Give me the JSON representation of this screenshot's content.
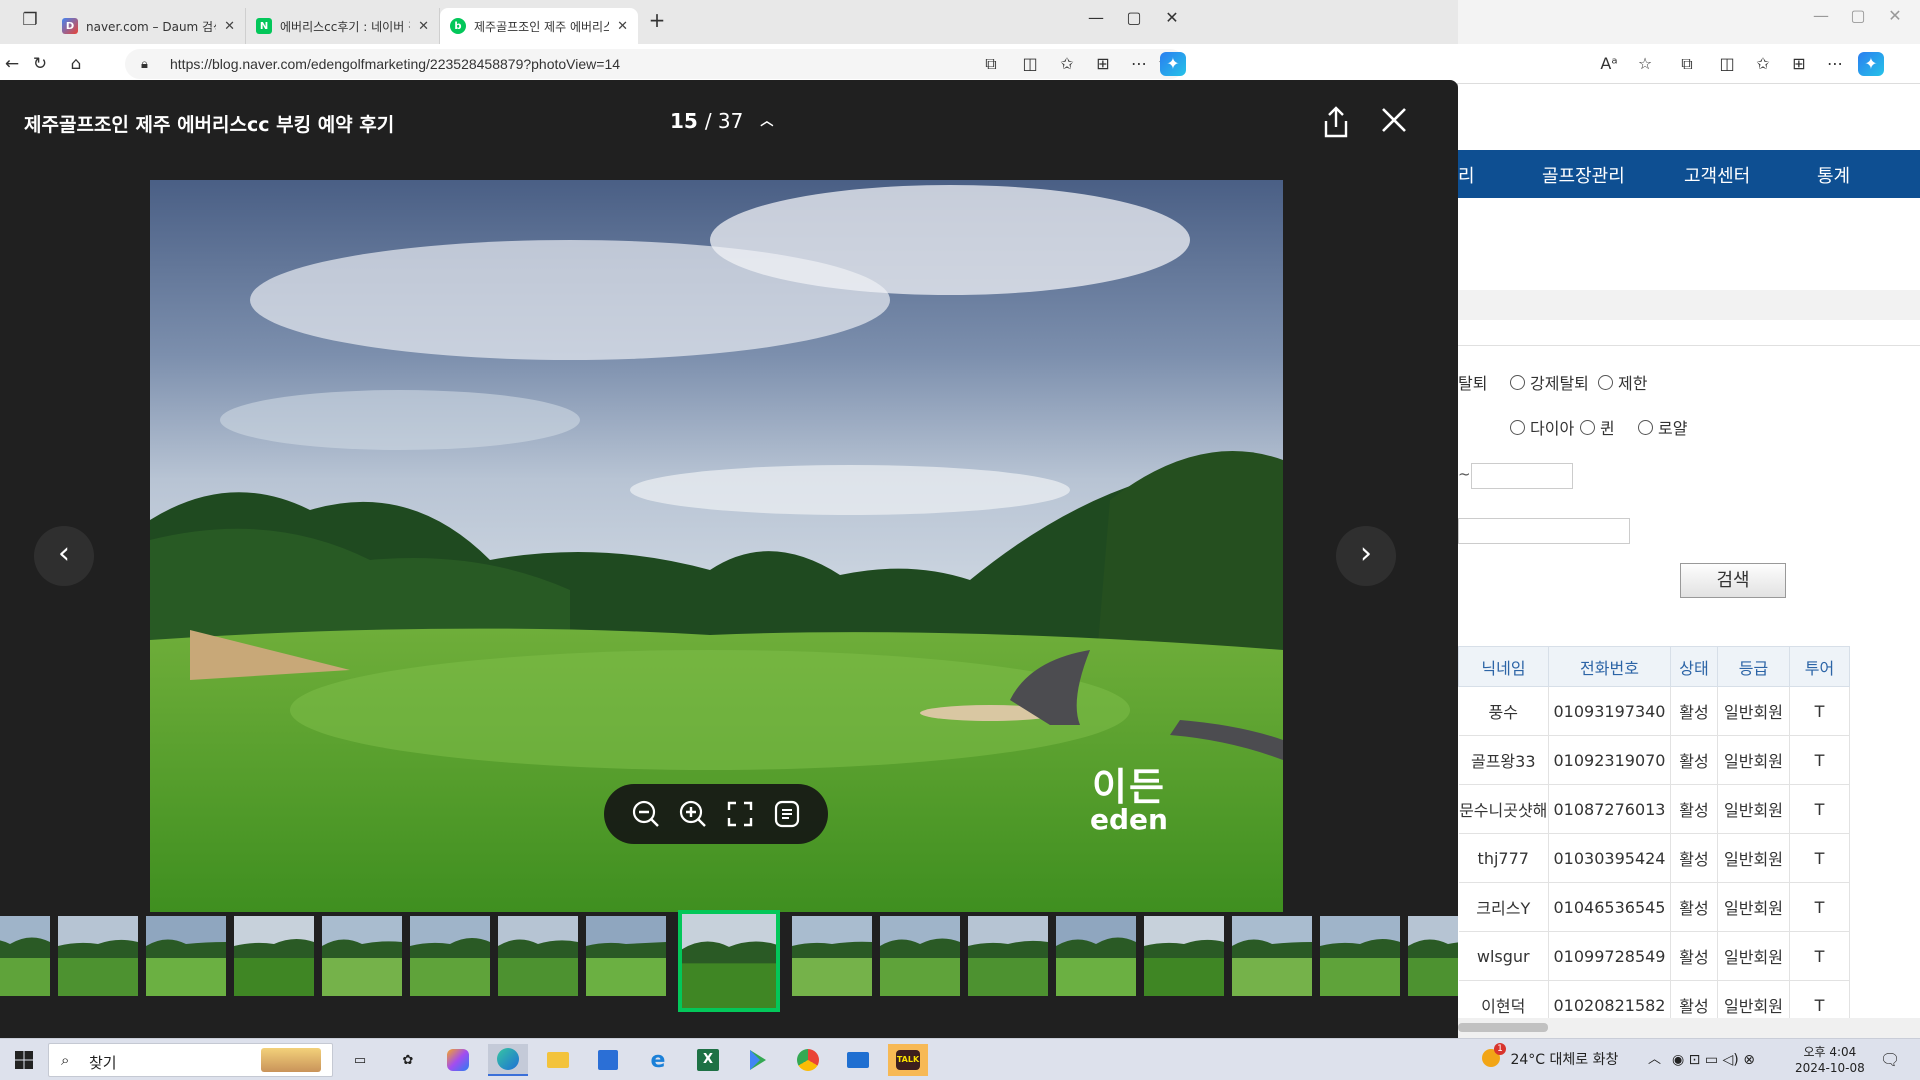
{
  "browser": {
    "tabs": [
      {
        "title": "naver.com – Daum 검색"
      },
      {
        "title": "에버리스cc후기 : 네이버 검색"
      },
      {
        "title": "제주골프조인 제주 에버리스cc 부"
      }
    ],
    "url": "https://blog.naver.com/edengolfmarketing/223528458879?photoView=14",
    "new_tab": "+",
    "minimize": "—",
    "maximize": "▢",
    "close": "✕"
  },
  "viewer": {
    "title": "제주골프조인 제주 에버리스cc 부킹 예약 후기",
    "current": "15",
    "total": "37",
    "watermark_kr": "이든",
    "watermark_en": "eden",
    "thumbnail_count": 17,
    "selected_thumbnail": 8
  },
  "admin": {
    "nav": [
      "리",
      "골프장관리",
      "고객센터",
      "통계"
    ],
    "radios_row1": [
      "탈퇴",
      "강제탈퇴",
      "제한"
    ],
    "radios_row2": [
      "다이아",
      "퀸",
      "로얄"
    ],
    "range_sep": "~",
    "search_button": "검색",
    "columns": [
      "닉네임",
      "전화번호",
      "상태",
      "등급",
      "투어"
    ],
    "rows": [
      [
        "풍수",
        "01093197340",
        "활성",
        "일반회원",
        "T"
      ],
      [
        "골프왕33",
        "01092319070",
        "활성",
        "일반회원",
        "T"
      ],
      [
        "문수니곳샷해",
        "01087276013",
        "활성",
        "일반회원",
        "T"
      ],
      [
        "thj777",
        "01030395424",
        "활성",
        "일반회원",
        "T"
      ],
      [
        "크리스Y",
        "01046536545",
        "활성",
        "일반회원",
        "T"
      ],
      [
        "wlsgur",
        "01099728549",
        "활성",
        "일반회원",
        "T"
      ],
      [
        "이현덕",
        "01020821582",
        "활성",
        "일반회원",
        "T"
      ]
    ]
  },
  "taskbar": {
    "search_label": "찾기",
    "weather": "24°C 대체로 화창",
    "time": "오후 4:04",
    "date": "2024-10-08",
    "badge": "1"
  },
  "colors": {
    "viewer_bg": "#202020",
    "selected_border": "#03c75a",
    "admin_nav": "#0e4f92",
    "table_header_text": "#2c64a6"
  }
}
